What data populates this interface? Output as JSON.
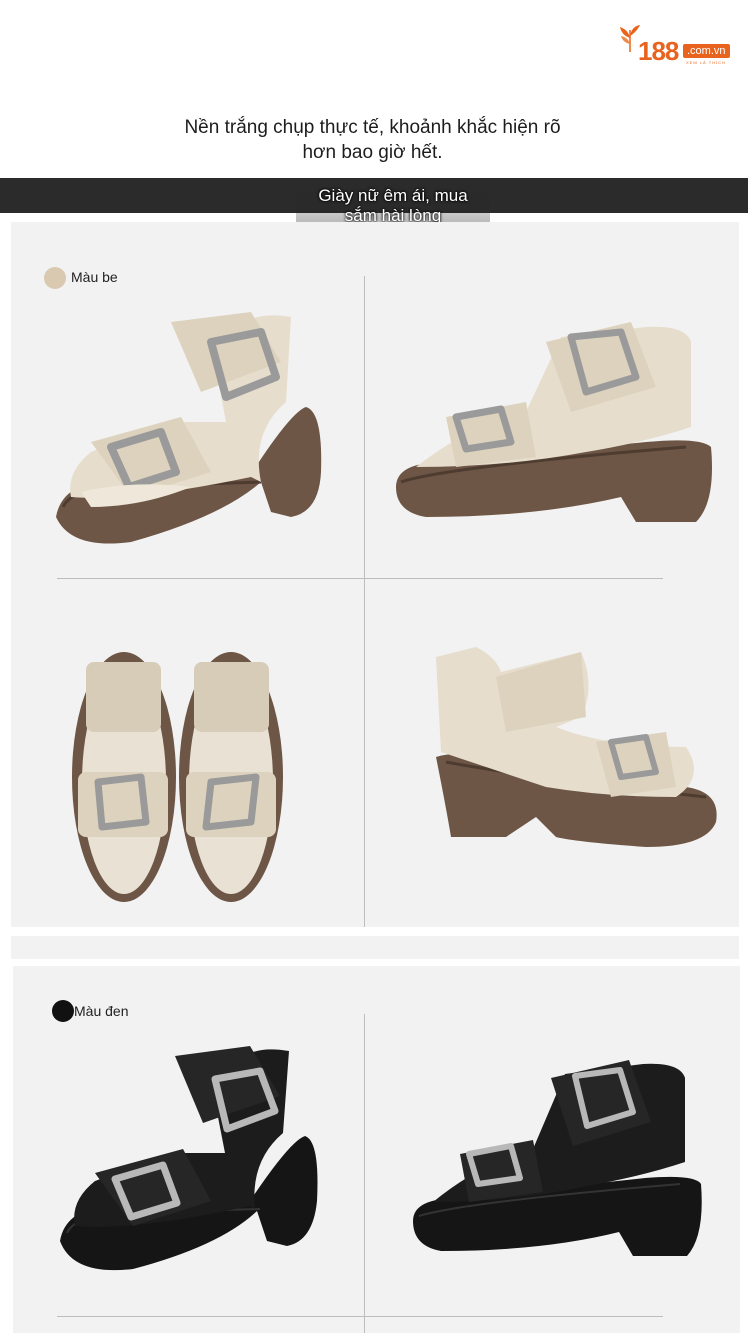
{
  "brand": {
    "logo_number": "188",
    "logo_domain": ".com.vn",
    "logo_tagline": "XEM LÀ THÍCH",
    "accent_color": "#e8641e"
  },
  "headline": {
    "line1": "Nền trắng chụp thực tế, khoảnh khắc hiện rõ",
    "line2": "hơn bao giờ hết."
  },
  "banner": {
    "line1": "Giày nữ êm ái, mua",
    "line2": "sắm hài lòng"
  },
  "variants": [
    {
      "label": "Màu be",
      "swatch_color": "#d8c9b0",
      "upper_color": "#e6ddcc",
      "sole_color": "#6e5646"
    },
    {
      "label": "Màu đen",
      "swatch_color": "#111111",
      "upper_color": "#1c1c1c",
      "sole_color": "#151515"
    }
  ],
  "icons": {
    "logo": "leaf-logo-icon",
    "buckle": "metal-buckle-icon"
  }
}
